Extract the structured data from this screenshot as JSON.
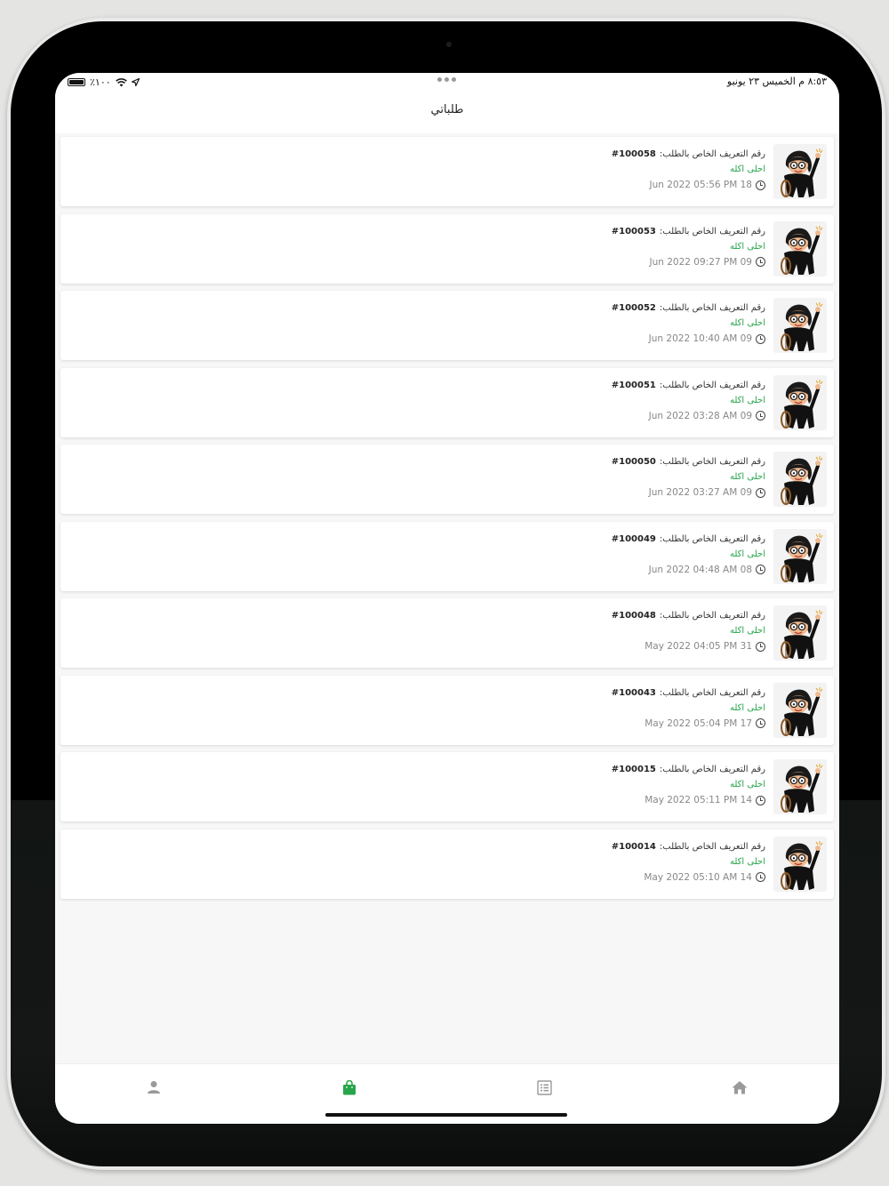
{
  "status_bar": {
    "time_date": "٨:٥٣ م  الخميس ٢٣ يونيو",
    "battery": "٪١٠٠"
  },
  "header": {
    "title": "طلباتي"
  },
  "orders": [
    {
      "id_label": "رقم التعريف الخاص بالطلب:",
      "id": "#100058",
      "status": "احلى اكله",
      "date": "Jun 2022  05:56 PM 18"
    },
    {
      "id_label": "رقم التعريف الخاص بالطلب:",
      "id": "#100053",
      "status": "احلى اكله",
      "date": "Jun 2022  09:27 PM 09"
    },
    {
      "id_label": "رقم التعريف الخاص بالطلب:",
      "id": "#100052",
      "status": "احلى اكله",
      "date": "Jun 2022  10:40 AM 09"
    },
    {
      "id_label": "رقم التعريف الخاص بالطلب:",
      "id": "#100051",
      "status": "احلى اكله",
      "date": "Jun 2022  03:28 AM 09"
    },
    {
      "id_label": "رقم التعريف الخاص بالطلب:",
      "id": "#100050",
      "status": "احلى اكله",
      "date": "Jun 2022  03:27 AM 09"
    },
    {
      "id_label": "رقم التعريف الخاص بالطلب:",
      "id": "#100049",
      "status": "احلى اكله",
      "date": "Jun 2022  04:48 AM 08"
    },
    {
      "id_label": "رقم التعريف الخاص بالطلب:",
      "id": "#100048",
      "status": "احلى اكله",
      "date": "May 2022  04:05 PM 31"
    },
    {
      "id_label": "رقم التعريف الخاص بالطلب:",
      "id": "#100043",
      "status": "احلى اكله",
      "date": "May 2022  05:04 PM 17"
    },
    {
      "id_label": "رقم التعريف الخاص بالطلب:",
      "id": "#100015",
      "status": "احلى اكله",
      "date": "May 2022  05:11 PM 14"
    },
    {
      "id_label": "رقم التعريف الخاص بالطلب:",
      "id": "#100014",
      "status": "احلى اكله",
      "date": "May 2022  05:10 AM 14"
    }
  ],
  "tab_bar": {
    "tabs": [
      {
        "icon": "home-icon",
        "active": false
      },
      {
        "icon": "list-icon",
        "active": false
      },
      {
        "icon": "shopping-bag-icon",
        "active": true
      },
      {
        "icon": "person-icon",
        "active": false
      }
    ],
    "active_color": "#27a54a",
    "inactive_color": "#9a9a9a"
  },
  "colors": {
    "status_green": "#27a54a",
    "background": "#f7f7f7"
  }
}
